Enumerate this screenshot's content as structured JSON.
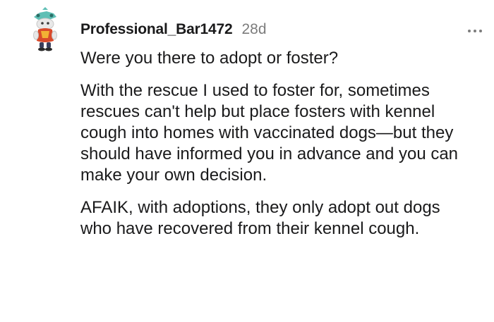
{
  "comment": {
    "author": "Professional_Bar1472",
    "age": "28d",
    "avatar_icon": "snoo-avatar-icon",
    "more_icon": "more-options-icon",
    "paragraphs": [
      "Were you there to adopt or foster?",
      "With the rescue I used to foster for, sometimes rescues can't help but place fosters with kennel cough into homes with vaccinated dogs—but they should have informed you in advance and you can make your own decision.",
      "AFAIK, with adoptions, they only adopt out dogs who have recovered from their kennel cough."
    ]
  }
}
